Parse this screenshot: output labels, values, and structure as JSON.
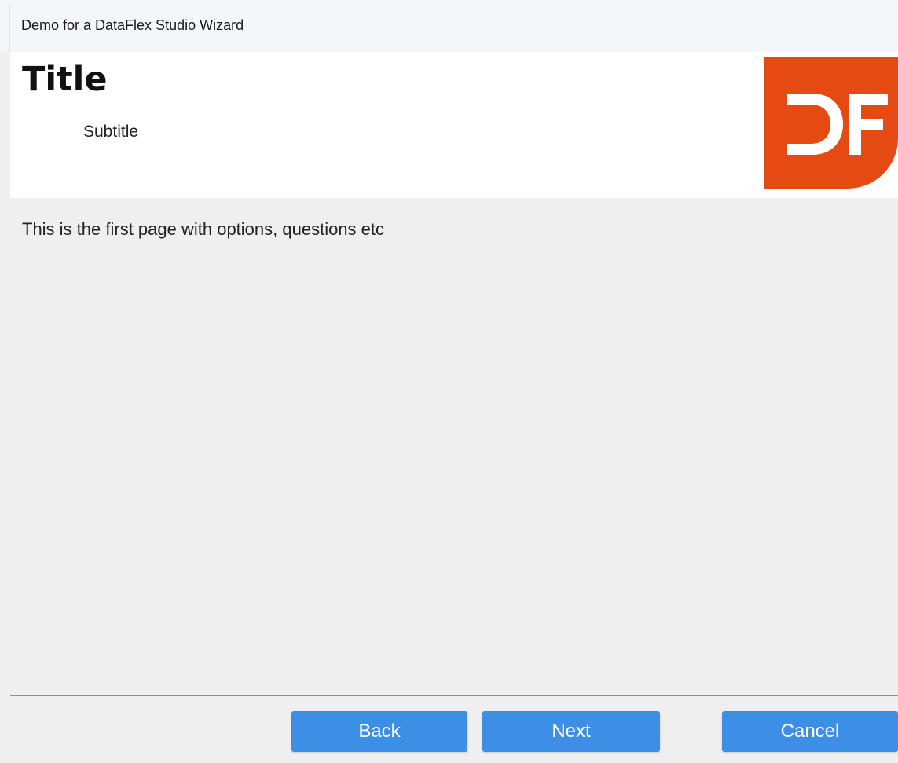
{
  "window": {
    "title": "Demo for a DataFlex Studio Wizard"
  },
  "header": {
    "title": "Title",
    "subtitle": "Subtitle",
    "logo_text": "DF",
    "logo_color": "#e44a11"
  },
  "content": {
    "text": "This is the first page with options, questions etc"
  },
  "footer": {
    "back_label": "Back",
    "next_label": "Next",
    "cancel_label": "Cancel",
    "button_color": "#3d8fe6"
  }
}
